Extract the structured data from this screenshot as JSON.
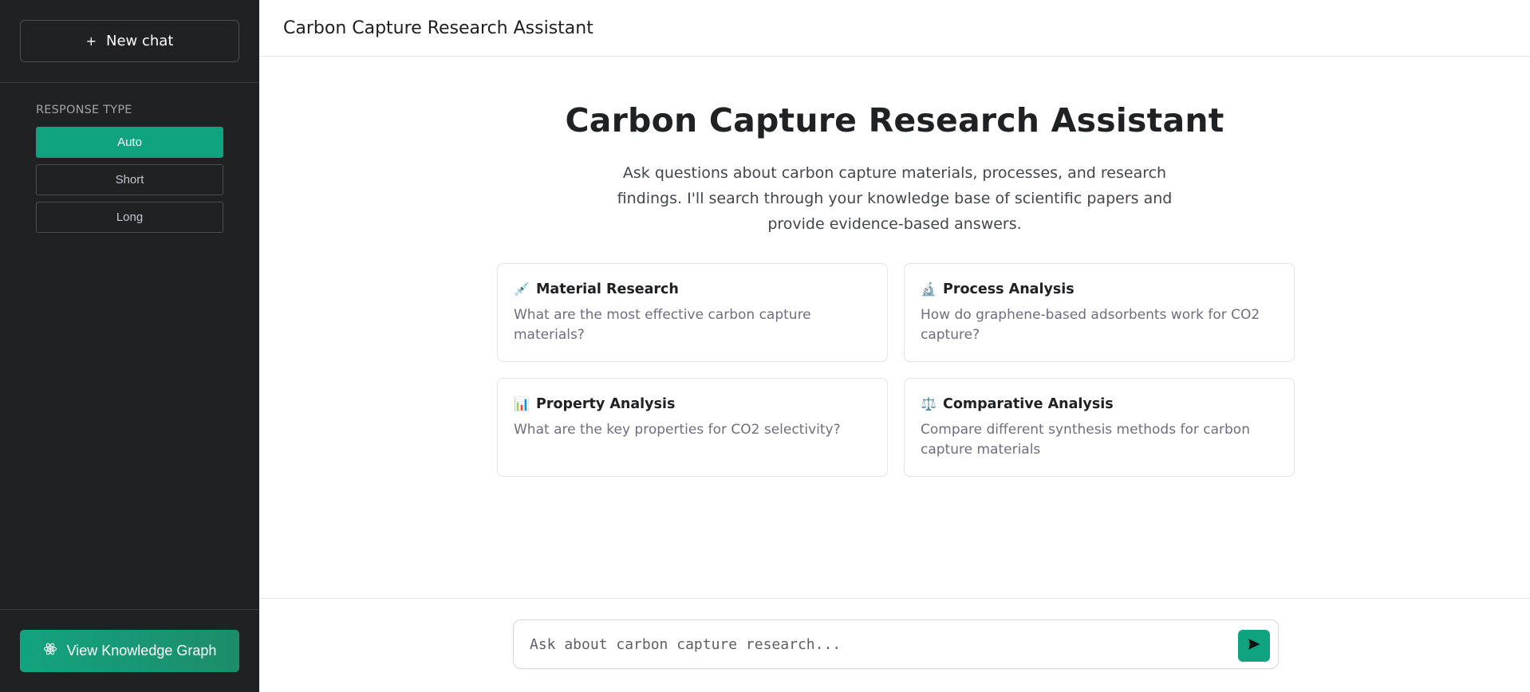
{
  "sidebar": {
    "new_chat": {
      "icon": "plus-icon",
      "label": "New chat",
      "plus": "+"
    },
    "response_type": {
      "title": "RESPONSE TYPE",
      "options": [
        {
          "label": "Auto",
          "active": true
        },
        {
          "label": "Short",
          "active": false
        },
        {
          "label": "Long",
          "active": false
        }
      ]
    },
    "knowledge_graph_button": {
      "icon": "atom-icon",
      "label": "View Knowledge Graph"
    }
  },
  "header": {
    "title": "Carbon Capture Research Assistant"
  },
  "hero": {
    "title": "Carbon Capture Research Assistant",
    "subtitle": "Ask questions about carbon capture materials, processes, and research findings. I'll search through your knowledge base of scientific papers and provide evidence-based answers."
  },
  "cards": [
    {
      "icon": "syringe-icon",
      "glyph": "💉",
      "title": "Material Research",
      "description": "What are the most effective carbon capture materials?"
    },
    {
      "icon": "microscope-icon",
      "glyph": "🔬",
      "title": "Process Analysis",
      "description": "How do graphene-based adsorbents work for CO2 capture?"
    },
    {
      "icon": "bar-chart-icon",
      "glyph": "📊",
      "title": "Property Analysis",
      "description": "What are the key properties for CO2 selectivity?"
    },
    {
      "icon": "scales-icon",
      "glyph": "⚖️",
      "title": "Comparative Analysis",
      "description": "Compare different synthesis methods for carbon capture materials"
    }
  ],
  "input": {
    "placeholder": "Ask about carbon capture research...",
    "value": ""
  },
  "send_button": {
    "icon": "send-icon"
  },
  "colors": {
    "accent": "#10a37f",
    "sidebar_bg": "#202123",
    "text_primary": "#202123",
    "text_secondary": "#6e6e80"
  }
}
